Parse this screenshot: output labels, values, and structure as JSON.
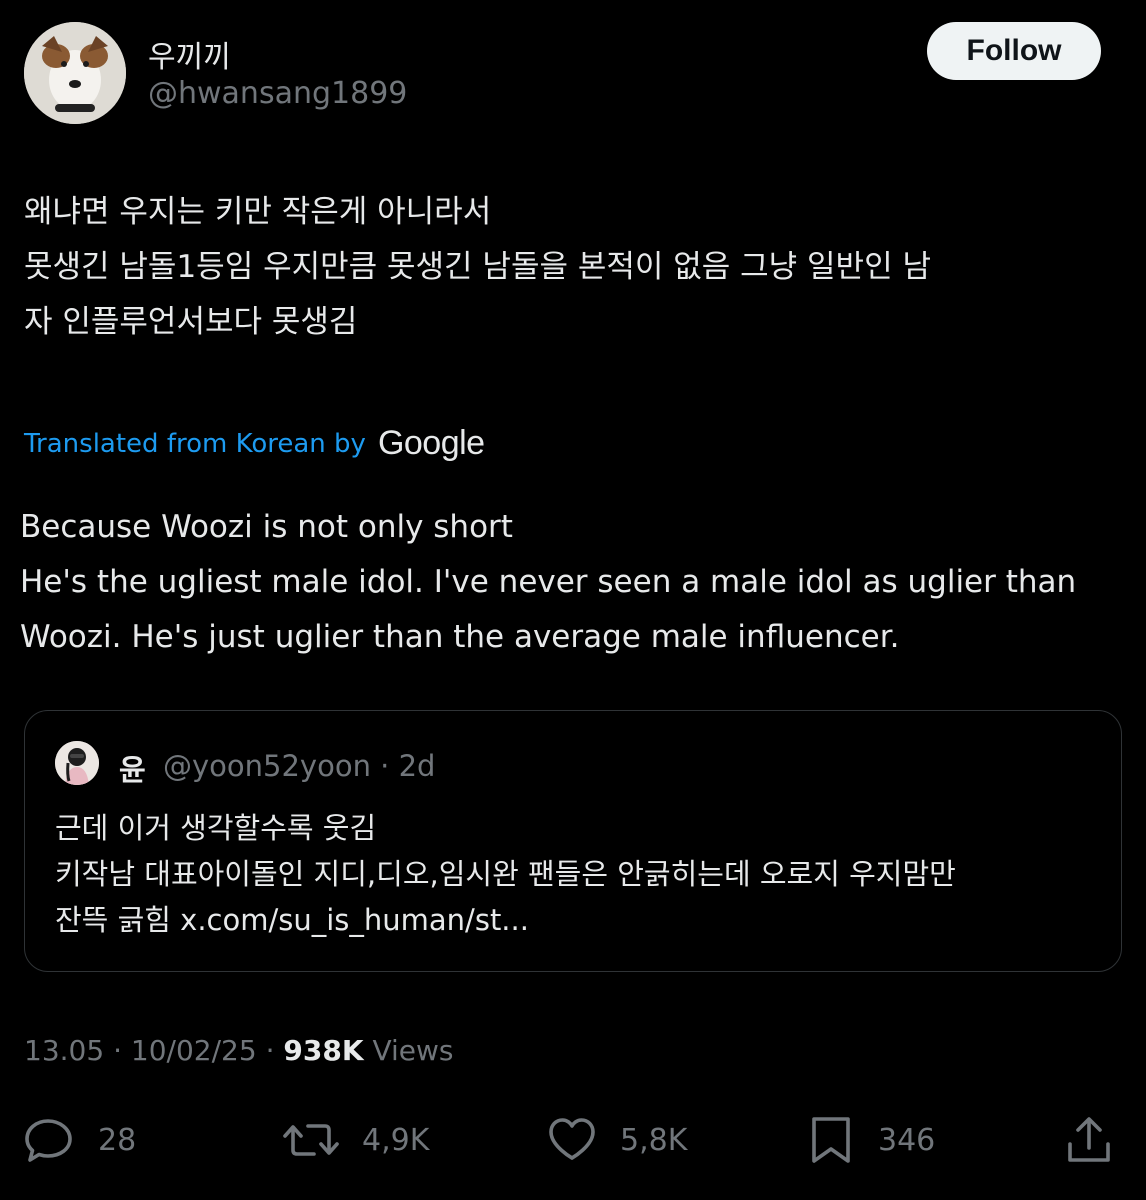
{
  "author": {
    "display_name": "우끼끼",
    "handle": "@hwansang1899",
    "follow_label": "Follow"
  },
  "tweet": {
    "lines": [
      "왜냐면 우지는 키만 작은게 아니라서",
      "못생긴 남돌1등임 우지만큼 못생긴 남돌을 본적이 없음 그냥 일반인 남",
      "자 인플루언서보다 못생김"
    ],
    "translated_label": "Translated from Korean by",
    "translated_brand": "Google",
    "translation_lines": [
      "Because Woozi is not only short",
      "He's the ugliest male idol. I've never seen a male idol as uglier than",
      "Woozi. He's just uglier than the average male influencer."
    ]
  },
  "quote": {
    "name": "윤",
    "meta": "@yoon52yoon · 2d",
    "lines": [
      "근데 이거 생각할수록 웃김",
      "키작남 대표아이돌인 지디,디오,임시완 팬들은 안긁히는데 오로지 우지맘만",
      "잔뜩 긁힘 x.com/su_is_human/st..."
    ]
  },
  "meta": {
    "time": "13.05",
    "date": "10/02/25",
    "separator": "·",
    "views_count": "938K",
    "views_label": "Views"
  },
  "actions": {
    "replies": "28",
    "reposts": "4,9K",
    "likes": "5,8K",
    "bookmarks": "346"
  },
  "icons": {
    "reply": "reply-icon",
    "repost": "repost-icon",
    "like": "heart-icon",
    "bookmark": "bookmark-icon",
    "share": "share-icon"
  },
  "colors": {
    "background": "#000000",
    "text": "#e7e9ea",
    "secondary": "#71767b",
    "link": "#1d9bf0",
    "border": "#2f3336"
  }
}
